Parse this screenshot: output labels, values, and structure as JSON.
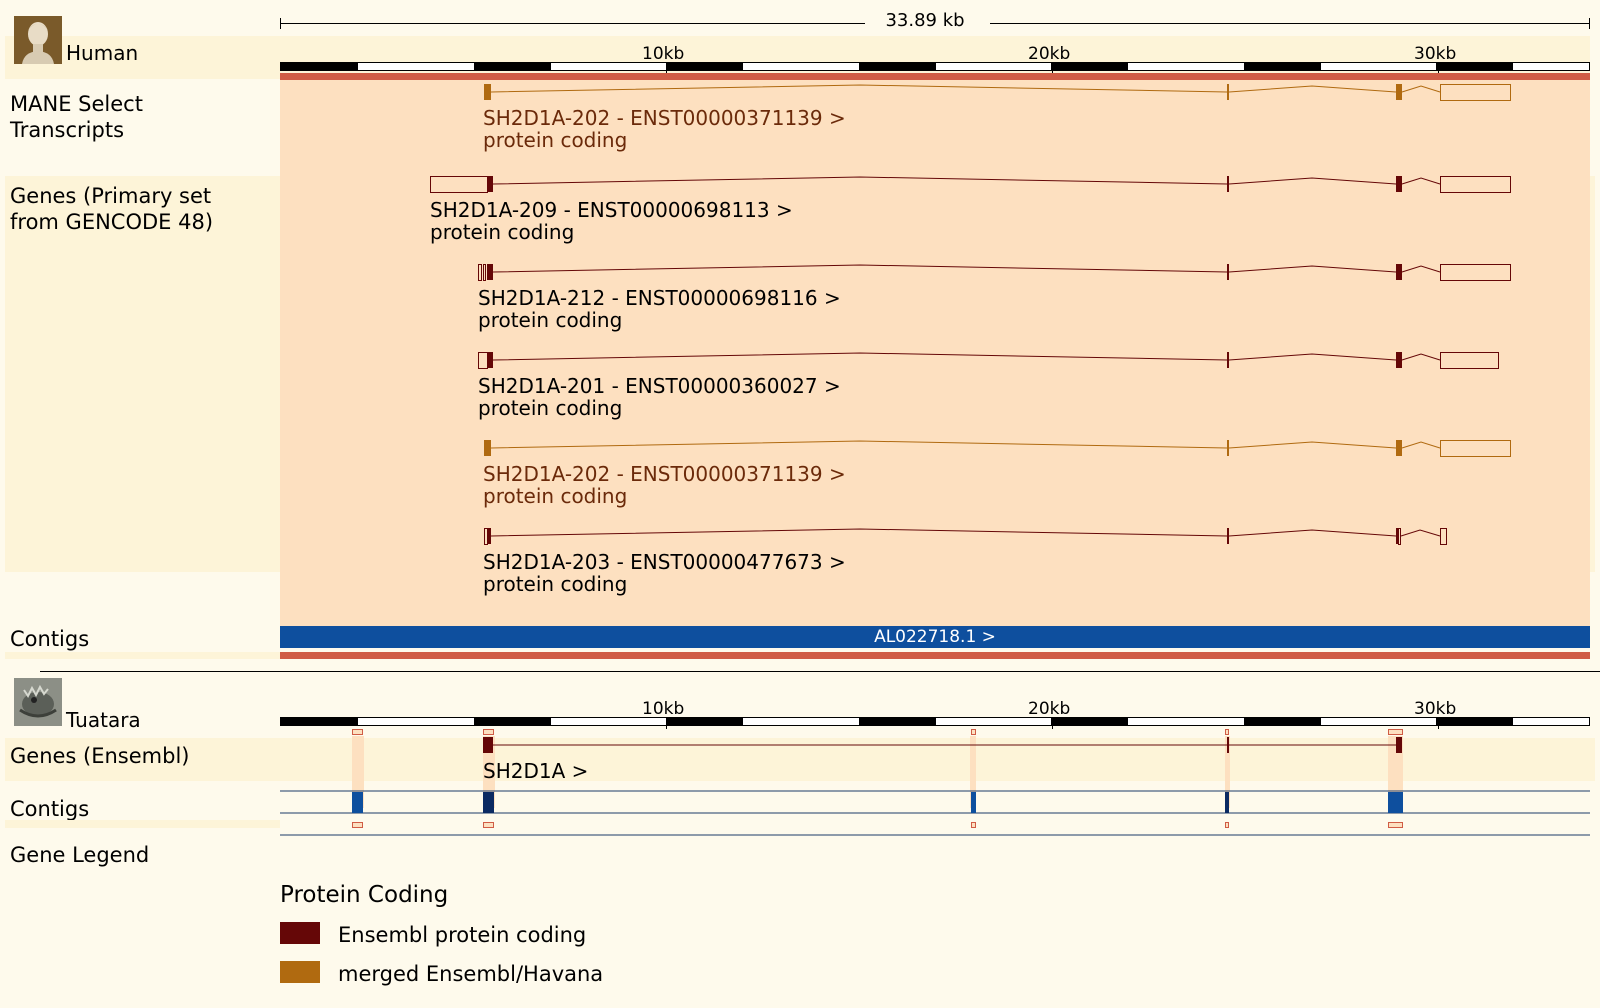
{
  "scale": {
    "span_label": "33.89 kb"
  },
  "human": {
    "species": "Human",
    "avatar_icon": "human-bust-icon",
    "ticks": [
      "10kb",
      "20kb",
      "30kb"
    ],
    "tracks": {
      "mane": "MANE Select Transcripts",
      "genes": "Genes (Primary set from GENCODE 48)",
      "contigs": "Contigs"
    },
    "transcripts": [
      {
        "name": "SH2D1A-202 - ENST00000371139 >",
        "biotype": "protein coding",
        "color": "#b06a10",
        "text_color": "#6b2a0a",
        "kind": "merged"
      },
      {
        "name": "SH2D1A-209 - ENST00000698113 >",
        "biotype": "protein coding",
        "color": "#650707",
        "text_color": "#000000",
        "kind": "ensembl"
      },
      {
        "name": "SH2D1A-212 - ENST00000698116 >",
        "biotype": "protein coding",
        "color": "#650707",
        "text_color": "#000000",
        "kind": "ensembl"
      },
      {
        "name": "SH2D1A-201 - ENST00000360027 >",
        "biotype": "protein coding",
        "color": "#650707",
        "text_color": "#000000",
        "kind": "ensembl"
      },
      {
        "name": "SH2D1A-202 - ENST00000371139 >",
        "biotype": "protein coding",
        "color": "#b06a10",
        "text_color": "#6b2a0a",
        "kind": "merged"
      },
      {
        "name": "SH2D1A-203 - ENST00000477673 >",
        "biotype": "protein coding",
        "color": "#650707",
        "text_color": "#000000",
        "kind": "ensembl"
      }
    ],
    "contig": {
      "label": "AL022718.1 >",
      "color": "#0e4f9e"
    }
  },
  "tuatara": {
    "species": "Tuatara",
    "avatar_icon": "tuatara-lizard-icon",
    "ticks": [
      "10kb",
      "20kb",
      "30kb"
    ],
    "tracks": {
      "genes": "Genes (Ensembl)",
      "contigs": "Contigs",
      "legend": "Gene Legend"
    },
    "gene": {
      "name": "SH2D1A >"
    }
  },
  "legend": {
    "title": "Protein Coding",
    "items": [
      {
        "label": "Ensembl protein coding",
        "color": "#650707"
      },
      {
        "label": "merged Ensembl/Havana",
        "color": "#b06a10"
      }
    ]
  },
  "colors": {
    "highlight": "#fde0c0",
    "band": "#fdf4d8",
    "red_bar": "#d05c45",
    "contig": "#0e4f9e"
  }
}
